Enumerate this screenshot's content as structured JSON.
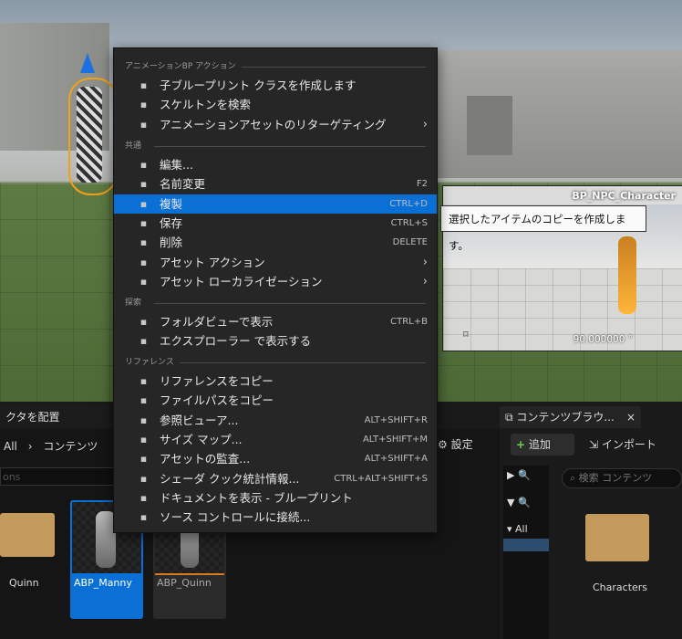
{
  "menu": {
    "sections": [
      {
        "title": "アニメーションBP アクション",
        "items": [
          {
            "icon": "node-tree-icon",
            "label": "子ブループリント クラスを作成します",
            "shortcut": "",
            "submenu": false
          },
          {
            "icon": "search-icon",
            "label": "スケルトンを検索",
            "shortcut": "",
            "submenu": false
          },
          {
            "icon": "retarget-icon",
            "label": "アニメーションアセットのリターゲティング",
            "shortcut": "",
            "submenu": true
          }
        ]
      },
      {
        "title": "共通",
        "items": [
          {
            "icon": "pencil-icon",
            "label": "編集...",
            "shortcut": "",
            "submenu": false
          },
          {
            "icon": "rename-icon",
            "label": "名前変更",
            "shortcut": "F2",
            "submenu": false
          },
          {
            "icon": "duplicate-icon",
            "label": "複製",
            "shortcut": "CTRL+D",
            "submenu": false,
            "selected": true
          },
          {
            "icon": "save-icon",
            "label": "保存",
            "shortcut": "CTRL+S",
            "submenu": false
          },
          {
            "icon": "trash-icon",
            "label": "削除",
            "shortcut": "DELETE",
            "submenu": false
          },
          {
            "icon": "wrench-icon",
            "label": "アセット アクション",
            "shortcut": "",
            "submenu": true
          },
          {
            "icon": "flag-icon",
            "label": "アセット ローカライゼーション",
            "shortcut": "",
            "submenu": true
          }
        ]
      },
      {
        "title": "探索",
        "items": [
          {
            "icon": "folder-search-icon",
            "label": "フォルダビューで表示",
            "shortcut": "CTRL+B",
            "submenu": false
          },
          {
            "icon": "folder-search-icon",
            "label": "エクスプローラー で表示する",
            "shortcut": "",
            "submenu": false
          }
        ]
      },
      {
        "title": "リファレンス",
        "items": [
          {
            "icon": "copy-reference-icon",
            "label": "リファレンスをコピー",
            "shortcut": "",
            "submenu": false
          },
          {
            "icon": "copy-path-icon",
            "label": "ファイルパスをコピー",
            "shortcut": "",
            "submenu": false
          },
          {
            "icon": "reference-viewer-icon",
            "label": "参照ビューア...",
            "shortcut": "ALT+SHIFT+R",
            "submenu": false
          },
          {
            "icon": "size-map-icon",
            "label": "サイズ マップ...",
            "shortcut": "ALT+SHIFT+M",
            "submenu": false
          },
          {
            "icon": "audit-icon",
            "label": "アセットの監査...",
            "shortcut": "ALT+SHIFT+A",
            "submenu": false
          },
          {
            "icon": "shader-icon",
            "label": "シェーダ クック統計情報...",
            "shortcut": "CTRL+ALT+SHIFT+S",
            "submenu": false
          },
          {
            "icon": "book-icon",
            "label": "ドキュメントを表示 - ブループリント",
            "shortcut": "",
            "submenu": false
          },
          {
            "icon": "source-control-icon",
            "label": "ソース コントロールに接続...",
            "shortcut": "",
            "submenu": false
          }
        ]
      }
    ]
  },
  "preview": {
    "title": "BP_NPC_Character",
    "tooltip": "選択したアイテムのコピーを作成します。",
    "zoom": "90.000000 °"
  },
  "place_tab": {
    "label": "クタを配置"
  },
  "left_panel": {
    "path_root": "All",
    "path_sep": "›",
    "path_current": "コンテンツ",
    "filter_placeholder": "ons",
    "settings_label": "設定",
    "assets": [
      {
        "name": "Quinn",
        "type": "folder"
      },
      {
        "name": "ABP_Manny",
        "type": "anim-blueprint",
        "selected": true
      },
      {
        "name": "ABP_Quinn",
        "type": "anim-blueprint"
      }
    ]
  },
  "content_browser": {
    "tab_label": "コンテンツブラウ...",
    "close": "×",
    "add_label": "追加",
    "import_label": "インポート",
    "search_placeholder": "検索 コンテンツ",
    "tree_root": "All",
    "folder_name": "Characters"
  },
  "colors": {
    "selected": "#0b70d6",
    "menu_bg": "#262626",
    "folder": "#c49a5c"
  }
}
